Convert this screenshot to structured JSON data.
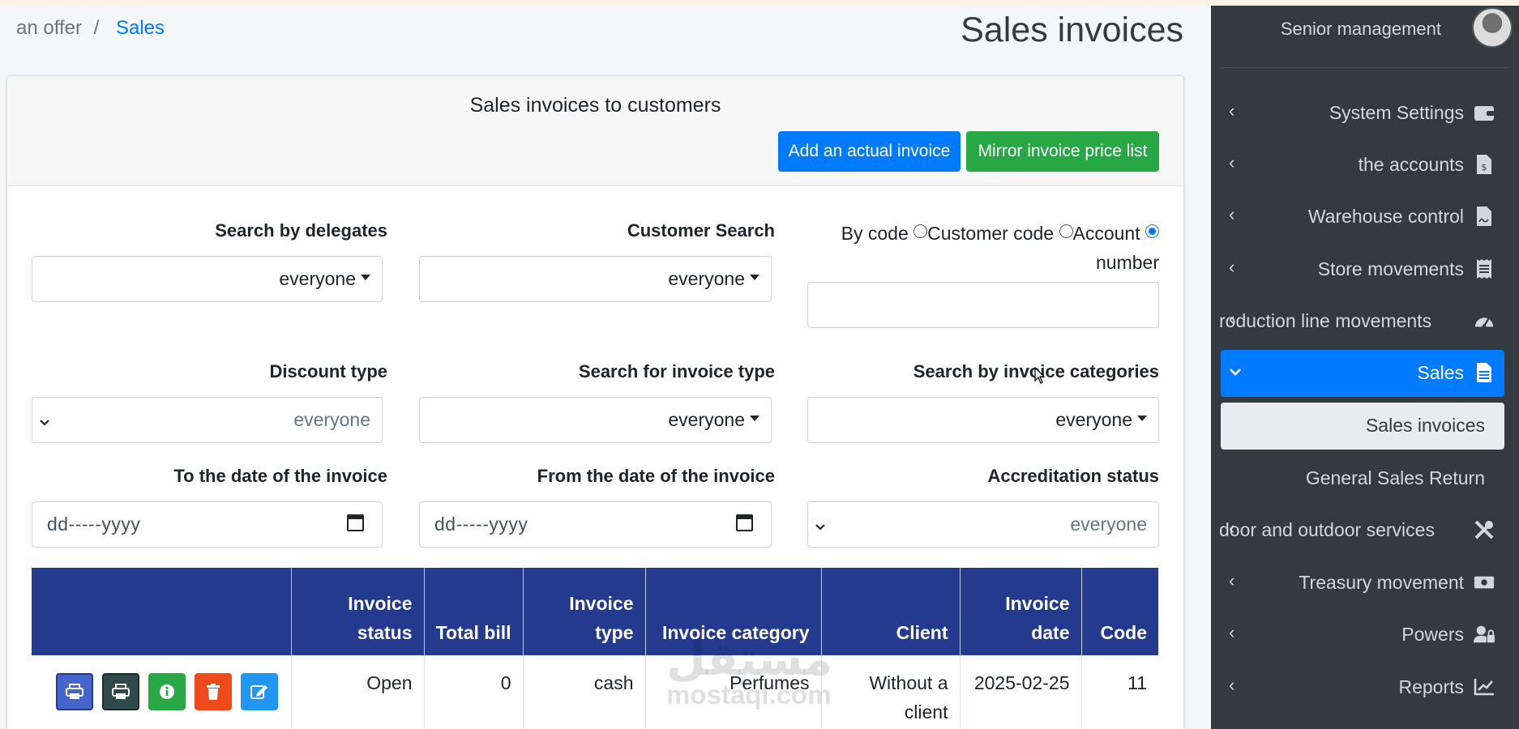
{
  "breadcrumb": {
    "root": "an offer",
    "separator": "/",
    "current": "Sales"
  },
  "page_title": "Sales invoices",
  "card": {
    "title": "Sales invoices to customers",
    "add_button": "Add an actual invoice",
    "mirror_button": "Mirror invoice price list"
  },
  "filters": {
    "delegates_label": "Search by delegates",
    "delegates_value": "everyone",
    "customer_label": "Customer Search",
    "customer_value": "everyone",
    "radio": {
      "by_code": "By code",
      "customer_code": "Customer code",
      "account": "Account",
      "number": "number"
    },
    "discount_label": "Discount type",
    "discount_value": "everyone",
    "invoice_type_label": "Search for invoice type",
    "invoice_type_value": "everyone",
    "categories_label": "Search by invoice categories",
    "categories_value": "everyone",
    "to_date_label": "To the date of the invoice",
    "to_date_placeholder": "dd-----yyyy",
    "from_date_label": "From the date of the invoice",
    "from_date_placeholder": "dd-----yyyy",
    "accreditation_label": "Accreditation status",
    "accreditation_value": "everyone"
  },
  "table": {
    "headers": [
      "",
      "Invoice status",
      "Total bill",
      "Invoice type",
      "Invoice category",
      "Client",
      "Invoice date",
      "Code"
    ],
    "rows": [
      {
        "status": "Open",
        "total": "0",
        "type": "cash",
        "category": "Perfumes",
        "client": "Without a client",
        "date": "2025-02-25",
        "code": "11"
      }
    ]
  },
  "watermark": {
    "arabic": "مستقل",
    "latin": "mostaql.com"
  },
  "sidebar": {
    "user": "Senior management",
    "items": [
      {
        "label": "System Settings",
        "icon": "wallet-icon"
      },
      {
        "label": "the accounts",
        "icon": "invoice-dollar-icon"
      },
      {
        "label": "Warehouse control",
        "icon": "file-signature-icon"
      },
      {
        "label": "Store movements",
        "icon": "receipt-icon"
      },
      {
        "label": "roduction line movements",
        "icon": "gauge-icon"
      },
      {
        "label": "Sales",
        "icon": "file-invoice-icon"
      },
      {
        "label": "Sales invoices"
      },
      {
        "label": "General Sales Return"
      },
      {
        "label": "door and outdoor services",
        "icon": "tools-icon"
      },
      {
        "label": "Treasury movement",
        "icon": "money-bill-icon"
      },
      {
        "label": "Powers",
        "icon": "user-lock-icon"
      },
      {
        "label": "Reports",
        "icon": "chart-line-icon"
      }
    ]
  },
  "colors": {
    "primary": "#007bff",
    "success": "#28a745",
    "table_header": "#233a8f",
    "sidebar": "#343a40"
  }
}
